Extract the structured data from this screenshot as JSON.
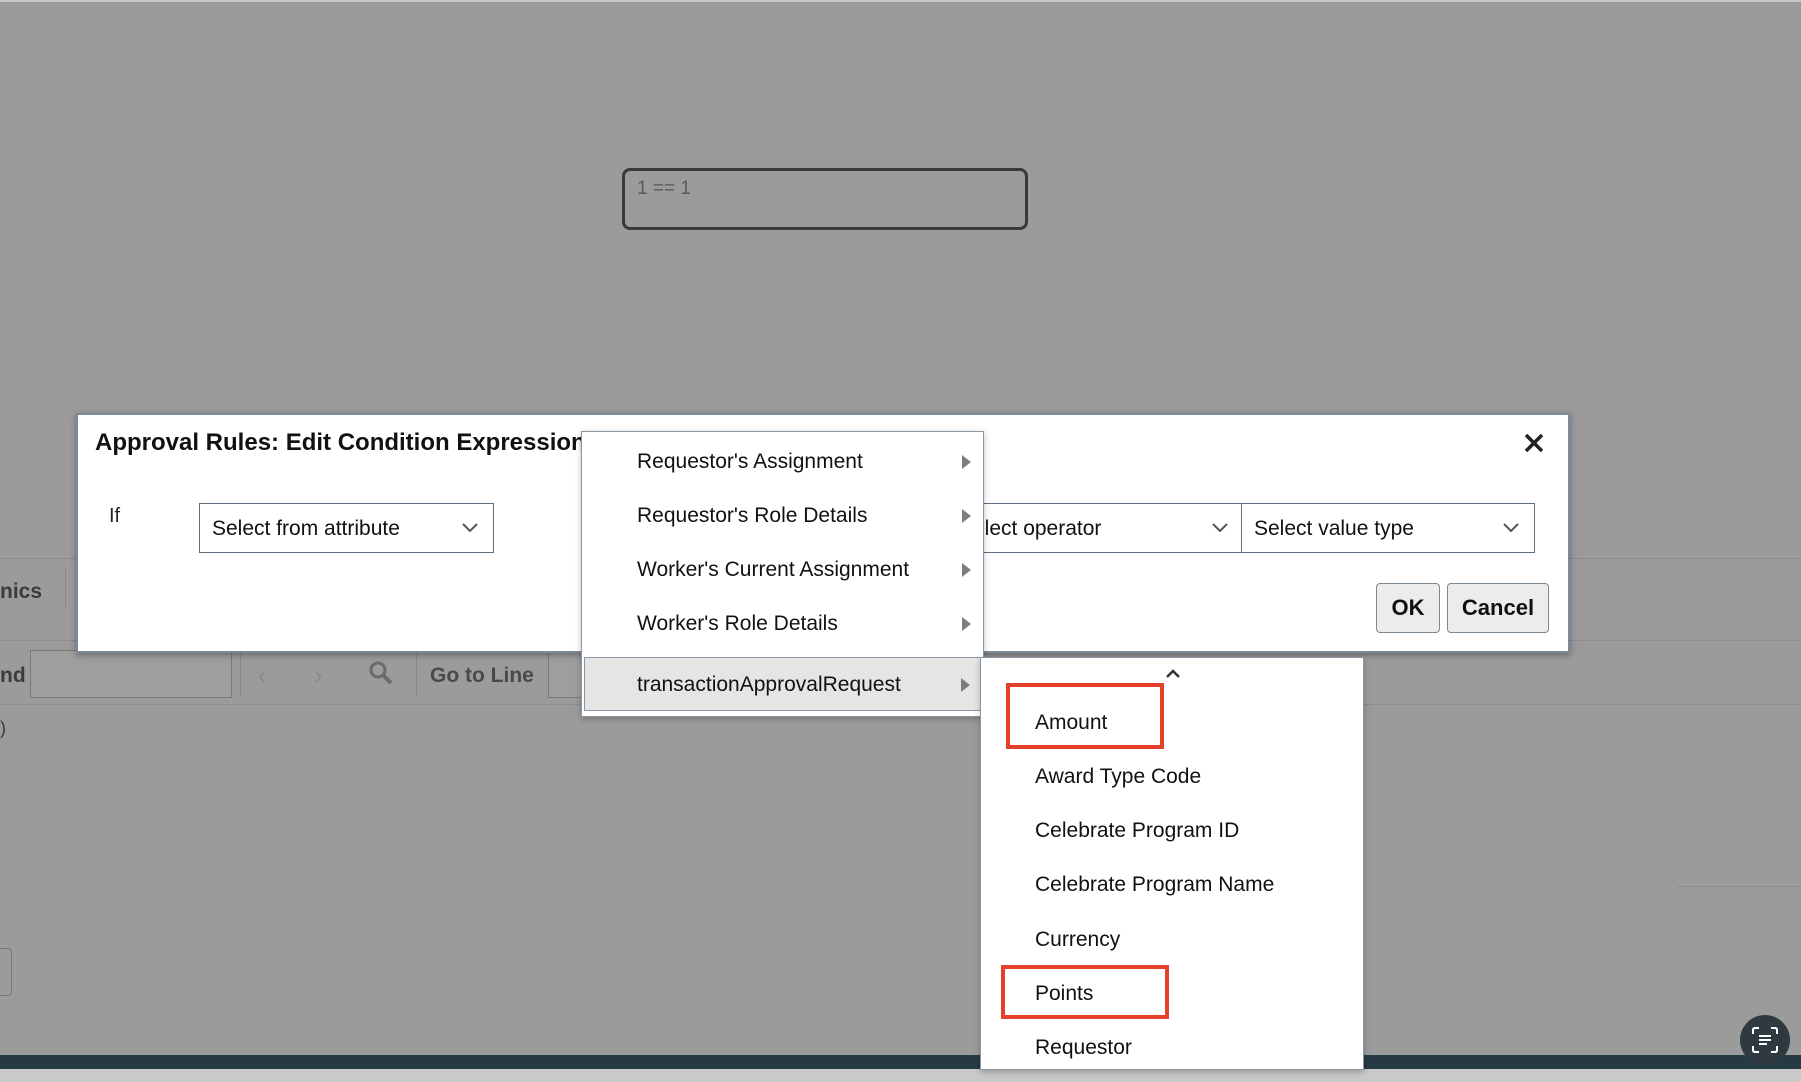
{
  "background": {
    "expression": "1 == 1",
    "tab_partial": "nics",
    "find_partial": "nd",
    "go_to_line": "Go to Line",
    "paren_partial": ")"
  },
  "dialog": {
    "title": "Approval Rules: Edit Condition Expression",
    "if_label": "If",
    "attribute_select": "Select from attribute",
    "operator_select": "Select operator",
    "value_type_select": "Select value type",
    "ok_label": "OK",
    "cancel_label": "Cancel"
  },
  "attribute_menu": {
    "items": [
      {
        "label": "Requestor's Assignment"
      },
      {
        "label": "Requestor's Role Details"
      },
      {
        "label": "Worker's Current Assignment"
      },
      {
        "label": "Worker's Role Details"
      },
      {
        "label": "transactionApprovalRequest",
        "active": true
      }
    ]
  },
  "submenu": {
    "items": [
      {
        "label": "Amount",
        "highlighted": true
      },
      {
        "label": "Award Type Code"
      },
      {
        "label": "Celebrate Program ID"
      },
      {
        "label": "Celebrate Program Name"
      },
      {
        "label": "Currency"
      },
      {
        "label": "Points",
        "highlighted": true
      },
      {
        "label": "Requestor"
      }
    ]
  },
  "colors": {
    "highlight": "#e5402a",
    "overlay": "#9b9b9b",
    "bottom_bar": "#263a44"
  }
}
